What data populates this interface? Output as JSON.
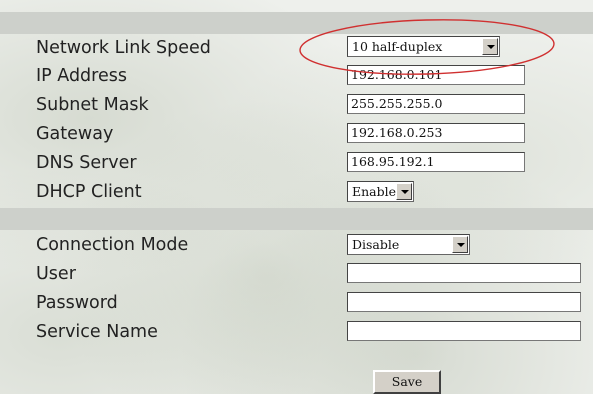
{
  "network": {
    "link_speed_label": "Network Link Speed",
    "link_speed_value": "10 half-duplex",
    "ip_label": "IP Address",
    "ip_value": "192.168.0.101",
    "subnet_label": "Subnet Mask",
    "subnet_value": "255.255.255.0",
    "gateway_label": "Gateway",
    "gateway_value": "192.168.0.253",
    "dns_label": "DNS Server",
    "dns_value": "168.95.192.1",
    "dhcp_label": "DHCP Client",
    "dhcp_value": "Enable"
  },
  "pppoe": {
    "mode_label": "Connection Mode",
    "mode_value": "Disable",
    "user_label": "User",
    "user_value": "",
    "password_label": "Password",
    "password_value": "",
    "service_label": "Service Name",
    "service_value": ""
  },
  "actions": {
    "save_label": "Save"
  },
  "colors": {
    "highlight_ellipse": "#d03030",
    "section_band": "#cdd0cb"
  }
}
